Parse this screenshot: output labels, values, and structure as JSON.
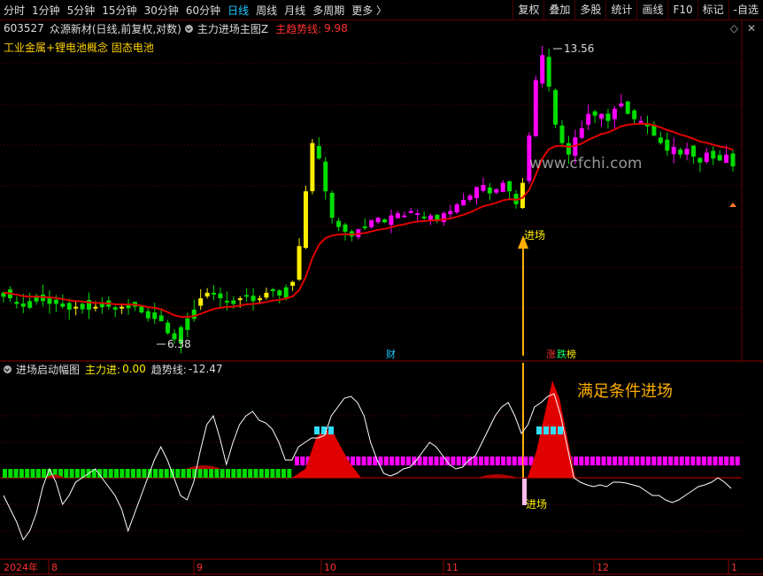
{
  "toolbar": {
    "tabs": [
      {
        "label": "分时",
        "active": false
      },
      {
        "label": "1分钟",
        "active": false
      },
      {
        "label": "5分钟",
        "active": false
      },
      {
        "label": "15分钟",
        "active": false
      },
      {
        "label": "30分钟",
        "active": false
      },
      {
        "label": "60分钟",
        "active": false
      },
      {
        "label": "日线",
        "active": true
      },
      {
        "label": "周线",
        "active": false
      },
      {
        "label": "月线",
        "active": false
      },
      {
        "label": "多周期",
        "active": false
      },
      {
        "label": "更多 〉",
        "active": false
      }
    ],
    "tools": [
      "复权",
      "叠加",
      "多股",
      "统计",
      "画线",
      "F10",
      "标记",
      "-自选"
    ]
  },
  "header": {
    "code": "603527",
    "name": "众源新材",
    "mode": "(日线,前复权,对数)",
    "indicator": "主力进场主图Z",
    "trend_label": "主趋势线:",
    "trend_value": "9.98",
    "concepts": "工业金属+锂电池概念  固态电池"
  },
  "main_chart": {
    "high_label": "13.56",
    "low_label": "6.38",
    "entry_label": "进场",
    "watermark": "www.cfchi.com",
    "event_labels": [
      "财",
      "涨",
      "跌",
      "榜"
    ]
  },
  "sub_panel": {
    "title": "进场启动幅图",
    "main_force_label": "主力进:",
    "main_force_value": "0.00",
    "trend_label": "趋势线:",
    "trend_value": "-12.47",
    "annotation": "满足条件进场",
    "entry_label": "进场"
  },
  "time_axis": {
    "labels": [
      "2024年",
      "8",
      "9",
      "10",
      "11",
      "12",
      "1"
    ]
  },
  "colors": {
    "up": "#ff00ff",
    "down": "#00dd00",
    "yellow_up": "#ffee00",
    "trend_line": "#e00000",
    "grid": "#6b0000",
    "accent": "#19c9ff",
    "annotation": "#ffae00"
  },
  "chart_data": [
    {
      "type": "candlestick",
      "title": "主力进场主图Z",
      "scale": "log",
      "price_max": 13.56,
      "price_min": 6.38,
      "trend_line_last": 9.98
    },
    {
      "type": "area",
      "title": "进场启动幅图",
      "series": [
        {
          "name": "主力进",
          "last": 0.0
        },
        {
          "name": "趋势线",
          "last": -12.47
        }
      ]
    }
  ]
}
